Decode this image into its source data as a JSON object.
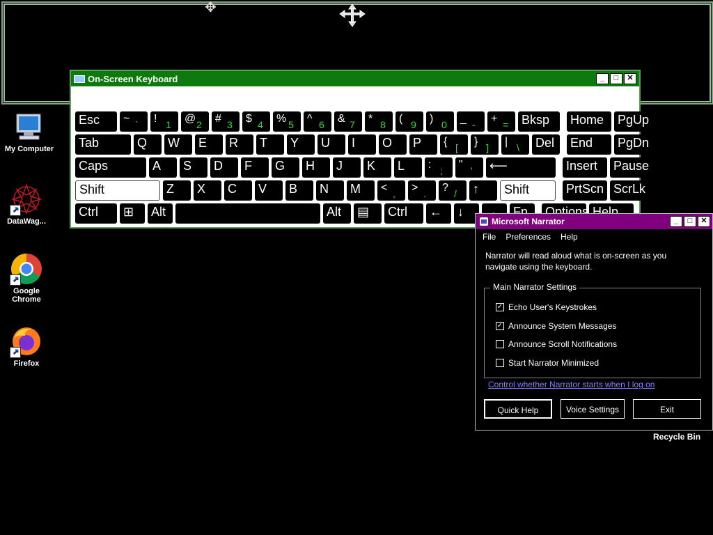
{
  "desktop": {
    "icons": [
      {
        "label": "My Computer",
        "icon": "computer-icon"
      },
      {
        "label": "DataWag...",
        "icon": "datawag-icon"
      },
      {
        "label": "Google Chrome",
        "icon": "chrome-icon"
      },
      {
        "label": "Firefox",
        "icon": "firefox-icon"
      }
    ],
    "recycle_bin_label": "Recycle Bin"
  },
  "osk": {
    "title": "On-Screen Keyboard",
    "controls": {
      "minimize": "_",
      "maximize": "□",
      "close": "✕"
    },
    "rows": [
      [
        {
          "t": "Esc"
        },
        {
          "s": "~",
          "n": "`"
        },
        {
          "s": "!",
          "n": "1"
        },
        {
          "s": "@",
          "n": "2"
        },
        {
          "s": "#",
          "n": "3"
        },
        {
          "s": "$",
          "n": "4"
        },
        {
          "s": "%",
          "n": "5"
        },
        {
          "s": "^",
          "n": "6"
        },
        {
          "s": "&",
          "n": "7"
        },
        {
          "s": "*",
          "n": "8"
        },
        {
          "s": "(",
          "n": "9"
        },
        {
          "s": ")",
          "n": "0"
        },
        {
          "s": "_",
          "n": "-"
        },
        {
          "s": "+",
          "n": "="
        },
        {
          "t": "Bksp"
        },
        {
          "t": "Home"
        },
        {
          "t": "PgUp"
        }
      ],
      [
        {
          "t": "Tab"
        },
        {
          "t": "Q"
        },
        {
          "t": "W"
        },
        {
          "t": "E"
        },
        {
          "t": "R"
        },
        {
          "t": "T"
        },
        {
          "t": "Y"
        },
        {
          "t": "U"
        },
        {
          "t": "I"
        },
        {
          "t": "O"
        },
        {
          "t": "P"
        },
        {
          "s": "{",
          "n": "["
        },
        {
          "s": "}",
          "n": "]"
        },
        {
          "s": "|",
          "n": "\\"
        },
        {
          "t": "Del"
        },
        {
          "t": "End"
        },
        {
          "t": "PgDn"
        }
      ],
      [
        {
          "t": "Caps"
        },
        {
          "t": "A"
        },
        {
          "t": "S"
        },
        {
          "t": "D"
        },
        {
          "t": "F"
        },
        {
          "t": "G"
        },
        {
          "t": "H"
        },
        {
          "t": "J"
        },
        {
          "t": "K"
        },
        {
          "t": "L"
        },
        {
          "s": ":",
          "n": ";"
        },
        {
          "s": "\"",
          "n": "'"
        },
        {
          "t": "⟵"
        },
        {
          "t": "Insert"
        },
        {
          "t": "Pause"
        }
      ],
      [
        {
          "t": "Shift"
        },
        {
          "t": "Z"
        },
        {
          "t": "X"
        },
        {
          "t": "C"
        },
        {
          "t": "V"
        },
        {
          "t": "B"
        },
        {
          "t": "N"
        },
        {
          "t": "M"
        },
        {
          "s": "<",
          "n": ","
        },
        {
          "s": ">",
          "n": "."
        },
        {
          "s": "?",
          "n": "/"
        },
        {
          "t": "↑"
        },
        {
          "t": "Shift"
        },
        {
          "t": "PrtScn"
        },
        {
          "t": "ScrLk"
        }
      ],
      [
        {
          "t": "Ctrl"
        },
        {
          "t": "⊞"
        },
        {
          "t": "Alt"
        },
        {
          "t": ""
        },
        {
          "t": "Alt"
        },
        {
          "t": "▤"
        },
        {
          "t": "Ctrl"
        },
        {
          "t": "←"
        },
        {
          "t": "↓"
        },
        {
          "t": "→"
        },
        {
          "t": "Fn"
        },
        {
          "t": "Options"
        },
        {
          "t": "Help"
        }
      ]
    ]
  },
  "narrator": {
    "title": "Microsoft Narrator",
    "menu": [
      "File",
      "Preferences",
      "Help"
    ],
    "description": "Narrator will read aloud what is on-screen as you navigate using the keyboard.",
    "group_label": "Main Narrator Settings",
    "options": [
      {
        "label": "Echo User's Keystrokes",
        "checked": true
      },
      {
        "label": "Announce System Messages",
        "checked": true
      },
      {
        "label": "Announce Scroll Notifications",
        "checked": false
      },
      {
        "label": "Start Narrator Minimized",
        "checked": false
      }
    ],
    "link": "Control whether Narrator starts when I log on",
    "buttons": {
      "quick_help": "Quick Help",
      "voice_settings": "Voice Settings",
      "exit": "Exit"
    },
    "controls": {
      "minimize": "_",
      "maximize": "□",
      "close": "✕"
    }
  },
  "colors": {
    "osk_title": "#0c7a0c",
    "narrator_title": "#800080",
    "numeric_hint": "#3cd83c",
    "link": "#7f7fff"
  }
}
